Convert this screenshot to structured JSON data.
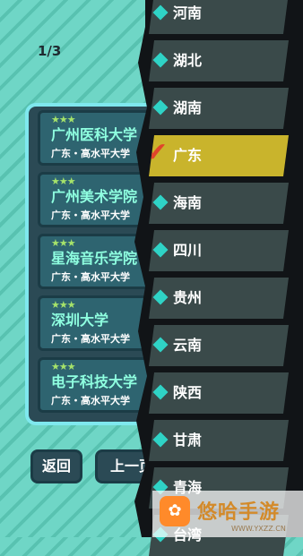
{
  "page_counter": "1/3",
  "schools": [
    {
      "stars": "★★★",
      "name": "广州医科大学",
      "meta": "广东・高水平大学"
    },
    {
      "stars": "★★★",
      "name": "广州美术学院",
      "meta": "广东・高水平大学"
    },
    {
      "stars": "★★★",
      "name": "星海音乐学院",
      "meta": "广东・高水平大学"
    },
    {
      "stars": "★★★",
      "name": "深圳大学",
      "meta": "广东・高水平大学"
    },
    {
      "stars": "★★★",
      "name": "电子科技大学",
      "meta": "广东・高水平大学"
    }
  ],
  "buttons": {
    "back": "返回",
    "prev": "上一页"
  },
  "provinces": [
    {
      "label": "河南",
      "selected": false
    },
    {
      "label": "湖北",
      "selected": false
    },
    {
      "label": "湖南",
      "selected": false
    },
    {
      "label": "广东",
      "selected": true
    },
    {
      "label": "海南",
      "selected": false
    },
    {
      "label": "四川",
      "selected": false
    },
    {
      "label": "贵州",
      "selected": false
    },
    {
      "label": "云南",
      "selected": false
    },
    {
      "label": "陕西",
      "selected": false
    },
    {
      "label": "甘肃",
      "selected": false
    },
    {
      "label": "青海",
      "selected": false
    },
    {
      "label": "台湾",
      "selected": false
    }
  ],
  "check_icon": "✔",
  "watermark": {
    "name": "悠哈手游",
    "url": "WWW.YXZZ.CN",
    "logo_glyph": "✿"
  },
  "colors": {
    "selected": "#c9b42c",
    "item": "#3a4a4a",
    "accent": "#2fd3c6",
    "check": "#e0452b"
  }
}
